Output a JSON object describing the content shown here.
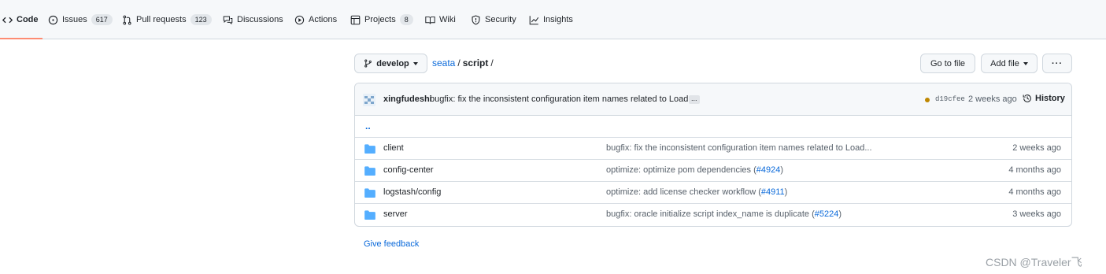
{
  "nav": {
    "tabs": [
      {
        "label": "Code",
        "icon": "code-icon",
        "selected": true
      },
      {
        "label": "Issues",
        "icon": "issue-icon",
        "count": "617"
      },
      {
        "label": "Pull requests",
        "icon": "pull-request-icon",
        "count": "123"
      },
      {
        "label": "Discussions",
        "icon": "discussions-icon"
      },
      {
        "label": "Actions",
        "icon": "play-icon"
      },
      {
        "label": "Projects",
        "icon": "table-icon",
        "count": "8"
      },
      {
        "label": "Wiki",
        "icon": "book-icon"
      },
      {
        "label": "Security",
        "icon": "shield-icon"
      },
      {
        "label": "Insights",
        "icon": "graph-icon"
      }
    ]
  },
  "branch": {
    "name": "develop",
    "icon": "git-branch-icon"
  },
  "breadcrumb": {
    "repo": "seata",
    "separator": "/",
    "path": "script",
    "trailing": "/"
  },
  "actions": {
    "go_to_file": "Go to file",
    "add_file": "Add file",
    "more": "···"
  },
  "latest_commit": {
    "author": "xingfudeshi",
    "message": "bugfix: fix the inconsistent configuration item names related to Load...",
    "expand": "...",
    "sha": "d19cfee",
    "status_color": "#bf8700",
    "time": "2 weeks ago",
    "history_label": "History"
  },
  "parent_dir": "..",
  "files": [
    {
      "name": "client",
      "message": "bugfix: fix the inconsistent configuration item names related to Load...",
      "pr": "",
      "age": "2 weeks ago"
    },
    {
      "name": "config-center",
      "message": "optimize: optimize pom dependencies (",
      "pr": "#4924",
      "suffix": ")",
      "age": "4 months ago"
    },
    {
      "name": "logstash/config",
      "message": "optimize: add license checker workflow (",
      "pr": "#4911",
      "suffix": ")",
      "age": "4 months ago"
    },
    {
      "name": "server",
      "message": "bugfix: oracle initialize script index_name is duplicate (",
      "pr": "#5224",
      "suffix": ")",
      "age": "3 weeks ago"
    }
  ],
  "feedback": "Give feedback",
  "watermark": "CSDN @Traveler飞",
  "colors": {
    "link": "#0969da",
    "folder": "#54aeff",
    "selected_underline": "#fd8c73",
    "muted": "#57606a"
  }
}
